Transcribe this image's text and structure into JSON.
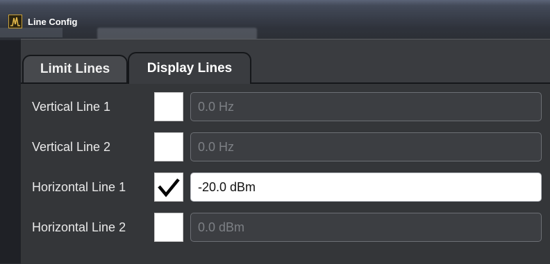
{
  "window": {
    "title": "Line Config",
    "icon": "spectrum-icon"
  },
  "tabs": [
    {
      "label": "Limit Lines",
      "active": false
    },
    {
      "label": "Display Lines",
      "active": true
    }
  ],
  "lines": [
    {
      "label": "Vertical Line 1",
      "checked": false,
      "value": "0.0 Hz"
    },
    {
      "label": "Vertical Line 2",
      "checked": false,
      "value": "0.0 Hz"
    },
    {
      "label": "Horizontal Line 1",
      "checked": true,
      "value": "-20.0 dBm"
    },
    {
      "label": "Horizontal Line 2",
      "checked": false,
      "value": "0.0 dBm"
    }
  ],
  "colors": {
    "accent_icon": "#c9a13b",
    "panel": "#3a3c40",
    "active_field": "#ffffff",
    "disabled_text": "#7d8085"
  }
}
